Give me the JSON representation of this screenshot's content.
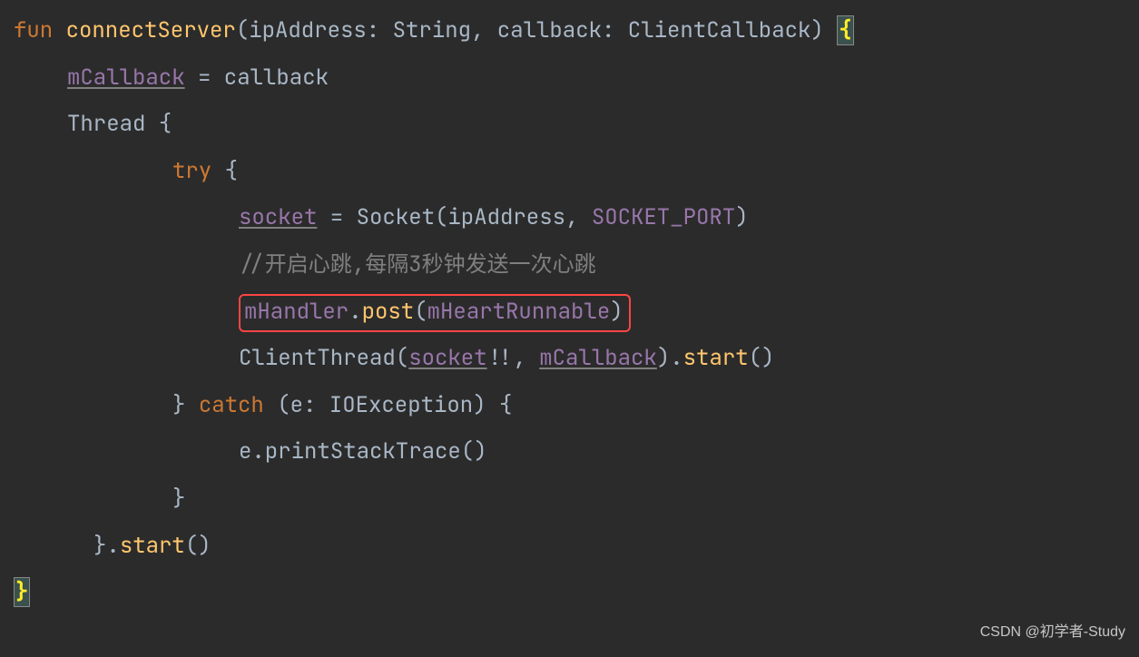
{
  "code": {
    "line1": {
      "fun": "fun",
      "name": "connectServer",
      "params_open": "(ipAddress: String, callback: ClientCallback) ",
      "brace": "{"
    },
    "line2": {
      "mCallback": "mCallback",
      "assign": " = callback"
    },
    "line3": {
      "thread": "Thread ",
      "brace": "{"
    },
    "line4": {
      "try": "try",
      "brace": " {"
    },
    "line5": {
      "socket": "socket",
      "assign": " = Socket(ipAddress, ",
      "port": "SOCKET_PORT",
      "close": ")"
    },
    "line6": {
      "comment": "//开启心跳,每隔3秒钟发送一次心跳"
    },
    "line7": {
      "mHandler": "mHandler",
      "dot": ".",
      "post": "post",
      "open": "(",
      "mHeartRunnable": "mHeartRunnable",
      "close": ")"
    },
    "line8": {
      "client": "ClientThread(",
      "socket": "socket",
      "bangs": "!!, ",
      "mCallback": "mCallback",
      "close": ").",
      "start": "start",
      "paren": "()"
    },
    "line9": {
      "close": "} ",
      "catch": "catch",
      "params": " (e: IOException) {"
    },
    "line10": {
      "print": "e.printStackTrace()"
    },
    "line11": {
      "close": "}"
    },
    "line12": {
      "close": "}.",
      "start": "start",
      "paren": "()"
    },
    "line13": {
      "brace": "}"
    }
  },
  "watermark": "CSDN @初学者-Study"
}
